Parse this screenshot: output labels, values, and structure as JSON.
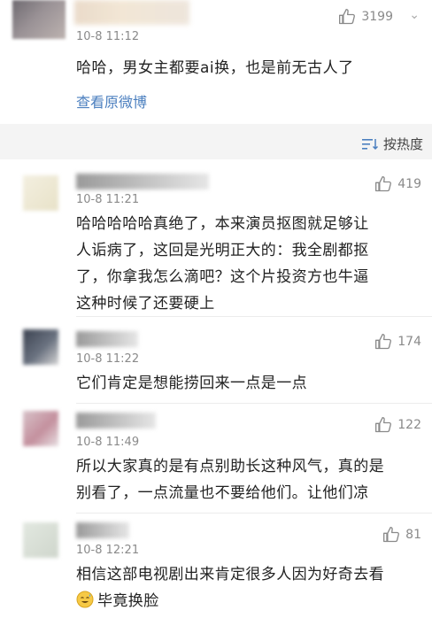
{
  "top_comment": {
    "time": "10-8 11:12",
    "likes": "3199",
    "text": "哈哈，男女主都要ai换，也是前无古人了",
    "link": "查看原微博",
    "more_glyph": "⌄"
  },
  "sort": {
    "icon": "sort-icon",
    "label": "按热度"
  },
  "comments": [
    {
      "time": "10-8 11:21",
      "likes": "419",
      "lines": [
        "哈哈哈哈哈真绝了，本来演员抠图就足够让",
        "人诟病了，这回是光明正大的：我全剧都抠",
        "了，你拿我怎么滴吧？这个片投资方也牛逼",
        "这种时候了还要硬上"
      ]
    },
    {
      "time": "10-8 11:22",
      "likes": "174",
      "lines": [
        "它们肯定是想能捞回来一点是一点"
      ]
    },
    {
      "time": "10-8 11:49",
      "likes": "122",
      "lines": [
        "所以大家真的是有点别助长这种风气，真的是",
        "别看了，一点流量也不要给他们。让他们凉"
      ]
    },
    {
      "time": "10-8 12:21",
      "likes": "81",
      "lines": [
        "相信这部电视剧出来肯定很多人因为好奇去看",
        "毕竟换脸"
      ],
      "emoji": "sweat-smile-emoji"
    }
  ],
  "colors": {
    "link": "#4b7fbf",
    "meta": "#8a8a8a",
    "background": "#f4f4f4"
  }
}
